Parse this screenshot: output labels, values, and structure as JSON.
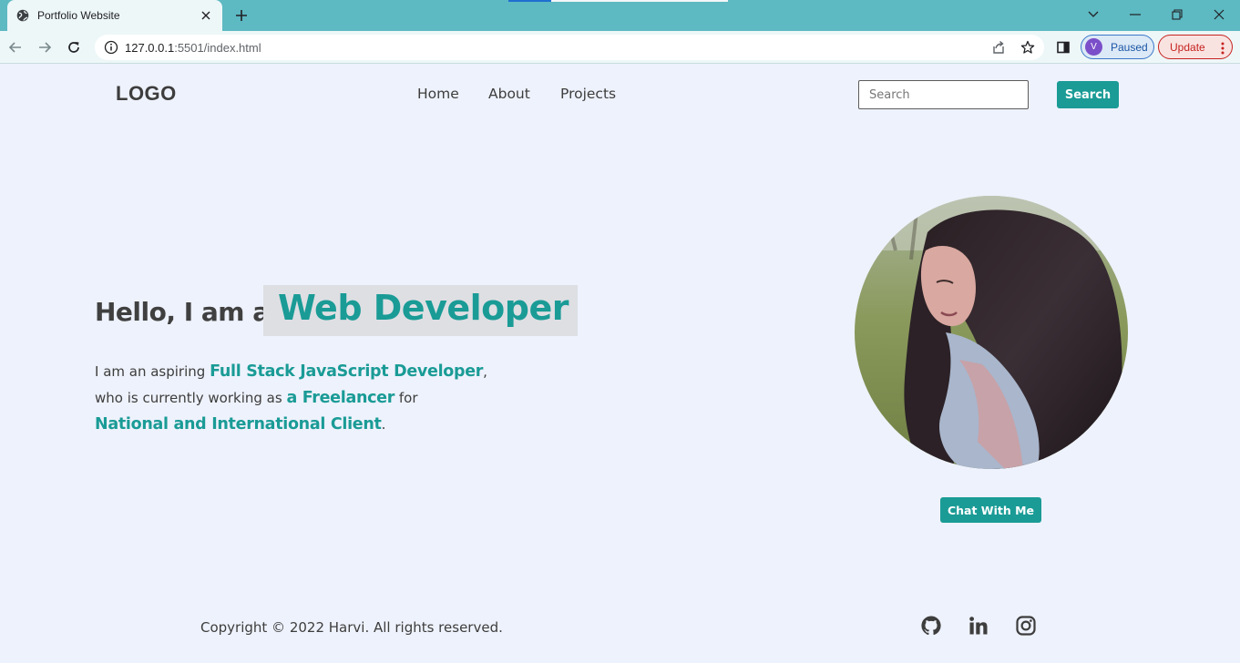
{
  "browser": {
    "tab_title": "Portfolio Website",
    "url_host": "127.0.0.1",
    "url_path": ":5501/index.html",
    "profile_initial": "V",
    "profile_status": "Paused",
    "update_label": "Update"
  },
  "header": {
    "logo": "LOGO",
    "nav": [
      "Home",
      "About",
      "Projects"
    ],
    "search_placeholder": "Search",
    "search_button": "Search"
  },
  "hero": {
    "greeting": "Hello, I am a",
    "role": "Web Developer",
    "intro_1": "I am an aspiring ",
    "intro_hl_1": "Full Stack JavaScript Developer",
    "intro_2": ",",
    "intro_3": "who is currently working as ",
    "intro_hl_2": "a Freelancer",
    "intro_4": " for",
    "intro_hl_3": "National and International Client",
    "intro_5": ".",
    "chat_button": "Chat With Me"
  },
  "footer": {
    "copyright": "Copyright © 2022 Harvi. All rights reserved."
  },
  "colors": {
    "accent": "#1a9b96",
    "page_bg": "#eef2fc",
    "tabstrip": "#5db9c2"
  },
  "icons": [
    "globe-icon",
    "close-icon",
    "plus-icon",
    "back-icon",
    "forward-icon",
    "reload-icon",
    "info-icon",
    "share-icon",
    "star-icon",
    "side-panel-icon",
    "github-icon",
    "linkedin-icon",
    "instagram-icon"
  ]
}
